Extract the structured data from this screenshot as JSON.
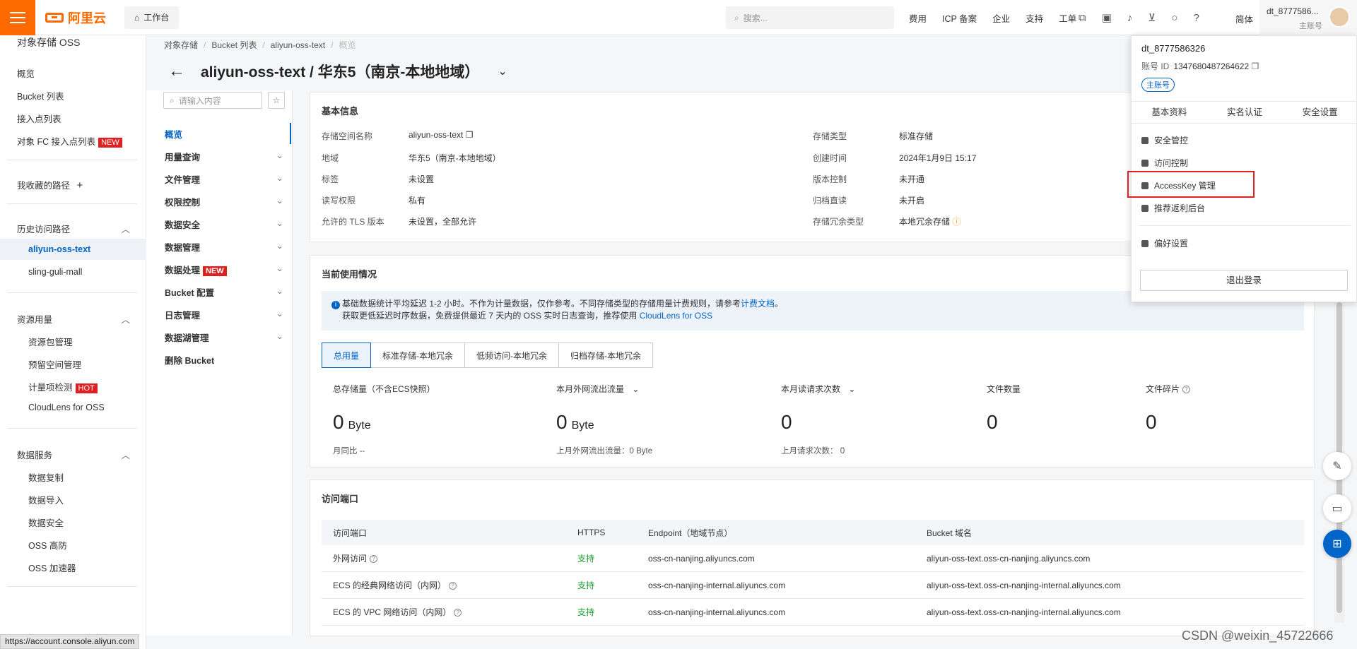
{
  "topbar": {
    "brand": "阿里云",
    "workbench": "工作台",
    "search_placeholder": "搜索...",
    "nav": [
      "费用",
      "ICP 备案",
      "企业",
      "支持",
      "工单"
    ],
    "icons": [
      "code-icon",
      "terminal-icon",
      "bell-icon",
      "cart-icon",
      "bulb-icon",
      "help-icon"
    ],
    "lang": "简体",
    "account_name": "dt_8777586...",
    "account_role": "主账号"
  },
  "sidebar": {
    "title": "对象存储 OSS",
    "items": [
      "概览",
      "Bucket 列表",
      "接入点列表",
      "对象 FC 接入点列表"
    ],
    "new_badge": "NEW",
    "favorites": "我收藏的路径",
    "history_title": "历史访问路径",
    "history": [
      "aliyun-oss-text",
      "sling-guli-mall"
    ],
    "resource_title": "资源用量",
    "resource": [
      "资源包管理",
      "预留空间管理",
      "计量项检测",
      "CloudLens for OSS"
    ],
    "hot_badge": "HOT",
    "data_title": "数据服务",
    "data": [
      "数据复制",
      "数据导入",
      "数据安全",
      "OSS 高防",
      "OSS 加速器"
    ]
  },
  "breadcrumb": [
    "对象存储",
    "Bucket 列表",
    "aliyun-oss-text",
    "概览"
  ],
  "page_title": "aliyun-oss-text / 华东5（南京-本地地域）",
  "subnav": {
    "search_placeholder": "请输入内容",
    "items": [
      "概览",
      "用量查询",
      "文件管理",
      "权限控制",
      "数据安全",
      "数据管理",
      "数据处理",
      "Bucket 配置",
      "日志管理",
      "数据湖管理",
      "删除 Bucket"
    ],
    "new_badge": "NEW"
  },
  "basic": {
    "title": "基本信息",
    "left": [
      {
        "k": "存储空间名称",
        "v": "aliyun-oss-text"
      },
      {
        "k": "地域",
        "v": "华东5（南京-本地地域）"
      },
      {
        "k": "标签",
        "v": "未设置"
      },
      {
        "k": "读写权限",
        "v": "私有"
      },
      {
        "k": "允许的 TLS 版本",
        "v": "未设置，全部允许"
      }
    ],
    "right": [
      {
        "k": "存储类型",
        "v": "标准存储"
      },
      {
        "k": "创建时间",
        "v": "2024年1月9日 15:17"
      },
      {
        "k": "版本控制",
        "v": "未开通"
      },
      {
        "k": "归档直读",
        "v": "未开启"
      },
      {
        "k": "存储冗余类型",
        "v": "本地冗余存储"
      }
    ]
  },
  "usage": {
    "title": "当前使用情况",
    "notice_line1": "基础数据统计平均延迟 1-2 小时。不作为计量数据，仅作参考。不同存储类型的存储用量计费规则，请参考",
    "notice_link1": "计费文档",
    "notice_line2": "获取更低延迟时序数据，免费提供最近 7 天内的 OSS 实时日志查询，推荐使用",
    "notice_link2": "CloudLens for OSS",
    "tabs": [
      "总用量",
      "标准存储-本地冗余",
      "低频访问-本地冗余",
      "归档存储-本地冗余"
    ],
    "metrics": [
      {
        "label": "总存储量（不含ECS快照）",
        "value": "0",
        "unit": "Byte",
        "sub": "月同比  --"
      },
      {
        "label": "本月外网流出流量",
        "value": "0",
        "unit": "Byte",
        "sub": "上月外网流出流量：0 Byte"
      },
      {
        "label": "本月读请求次数",
        "value": "0",
        "unit": "",
        "sub": "上月请求次数：  0"
      },
      {
        "label": "文件数量",
        "value": "0",
        "unit": "",
        "sub": ""
      },
      {
        "label": "文件碎片",
        "value": "0",
        "unit": "",
        "sub": ""
      }
    ]
  },
  "access": {
    "title": "访问端口",
    "headers": [
      "访问端口",
      "HTTPS",
      "Endpoint（地域节点）",
      "Bucket 域名"
    ],
    "rows": [
      [
        "外网访问",
        "支持",
        "oss-cn-nanjing.aliyuncs.com",
        "aliyun-oss-text.oss-cn-nanjing.aliyuncs.com"
      ],
      [
        "ECS 的经典网络访问（内网）",
        "支持",
        "oss-cn-nanjing-internal.aliyuncs.com",
        "aliyun-oss-text.oss-cn-nanjing-internal.aliyuncs.com"
      ],
      [
        "ECS 的 VPC 网络访问（内网）",
        "支持",
        "oss-cn-nanjing-internal.aliyuncs.com",
        "aliyun-oss-text.oss-cn-nanjing-internal.aliyuncs.com"
      ]
    ]
  },
  "dropdown": {
    "username": "dt_8777586326",
    "id_label": "账号 ID",
    "id_value": "1347680487264622",
    "role": "主账号",
    "tabs": [
      "基本资料",
      "实名认证",
      "安全设置"
    ],
    "menu": [
      "安全管控",
      "访问控制",
      "AccessKey 管理",
      "推荐返利后台",
      "偏好设置"
    ],
    "logout": "退出登录"
  },
  "status_url": "https://account.console.aliyun.com",
  "watermark": "CSDN @weixin_45722666",
  "colors": {
    "brand": "#ff6a00",
    "accent": "#0064c8",
    "highlight": "#e02020",
    "success": "#1a9c2e"
  }
}
